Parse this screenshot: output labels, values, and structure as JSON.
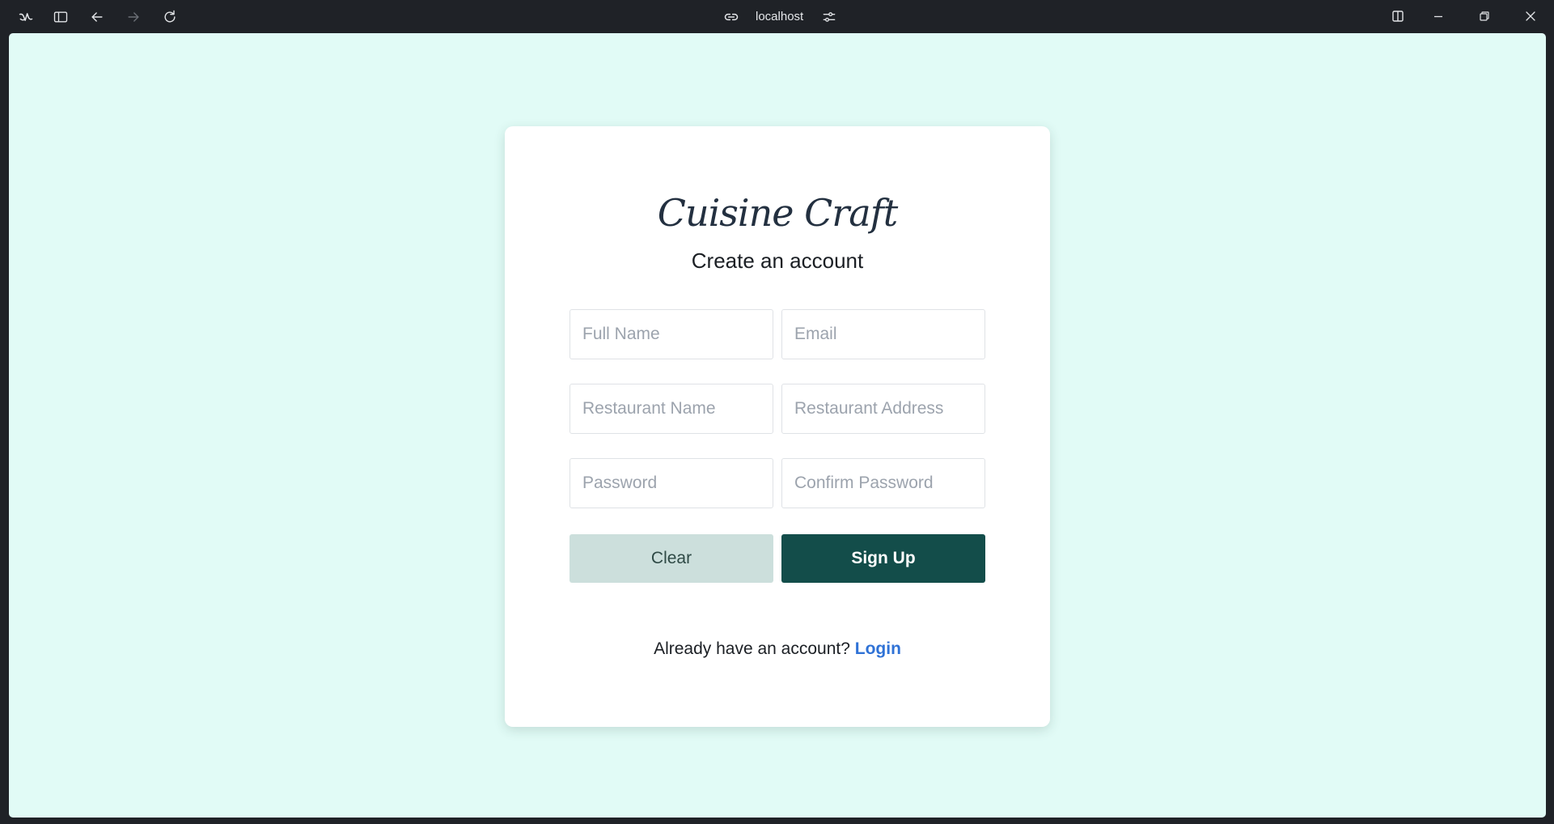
{
  "browser": {
    "url": "localhost",
    "icons": {
      "app": "browser-logo-icon",
      "sidebar": "sidebar-toggle-icon",
      "back": "arrow-left-icon",
      "forward": "arrow-right-icon",
      "reload": "reload-icon",
      "link": "link-icon",
      "settings": "sliders-icon",
      "split": "split-view-icon",
      "minimize": "minimize-icon",
      "restore": "restore-icon",
      "close": "close-icon"
    }
  },
  "page": {
    "background": "#e1fbf6",
    "logo": "Cuisine Craft",
    "subtitle": "Create an account",
    "fields": {
      "full_name": "Full Name",
      "email": "Email",
      "restaurant_name": "Restaurant Name",
      "restaurant_address": "Restaurant Address",
      "password": "Password",
      "confirm_password": "Confirm Password"
    },
    "buttons": {
      "clear": "Clear",
      "signup": "Sign Up"
    },
    "login_prompt": "Already have an account?",
    "login_link": "Login",
    "colors": {
      "primary": "#134d4a",
      "secondary": "#ccdfdc",
      "link": "#2f72d6"
    }
  }
}
